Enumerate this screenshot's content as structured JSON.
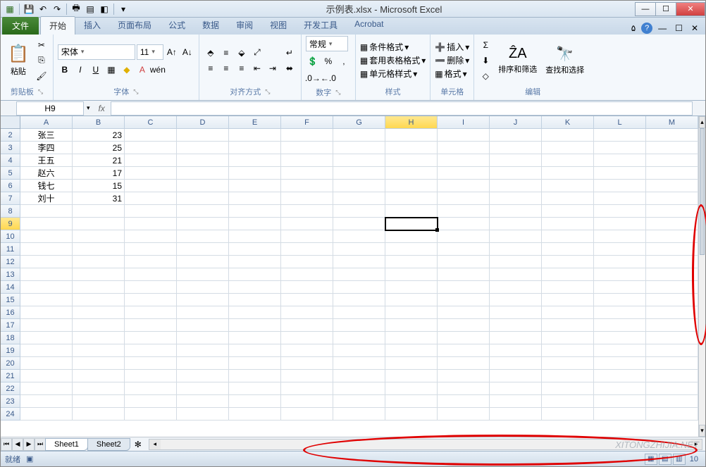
{
  "title": "示例表.xlsx - Microsoft Excel",
  "tabs": {
    "file": "文件",
    "items": [
      "开始",
      "插入",
      "页面布局",
      "公式",
      "数据",
      "审阅",
      "视图",
      "开发工具",
      "Acrobat"
    ],
    "active": 0
  },
  "ribbon": {
    "clipboard": {
      "paste": "粘贴",
      "label": "剪贴板"
    },
    "font": {
      "name": "宋体",
      "size": "11",
      "label": "字体"
    },
    "align": {
      "label": "对齐方式"
    },
    "number": {
      "format": "常规",
      "label": "数字"
    },
    "styles": {
      "cond": "条件格式",
      "table": "套用表格格式",
      "cell": "单元格样式",
      "label": "样式"
    },
    "cells": {
      "insert": "插入",
      "delete": "删除",
      "format": "格式",
      "label": "单元格"
    },
    "editing": {
      "sort": "排序和筛选",
      "find": "查找和选择",
      "label": "编辑"
    }
  },
  "nameBox": "H9",
  "columns": [
    "A",
    "B",
    "C",
    "D",
    "E",
    "F",
    "G",
    "H",
    "I",
    "J",
    "K",
    "L",
    "M"
  ],
  "rows": [
    2,
    3,
    4,
    5,
    6,
    7,
    8,
    9,
    10,
    11,
    12,
    13,
    14,
    15,
    16,
    17,
    18,
    19,
    20,
    21,
    22,
    23,
    24
  ],
  "data": {
    "2": {
      "A": "张三",
      "B": "23"
    },
    "3": {
      "A": "李四",
      "B": "25"
    },
    "4": {
      "A": "王五",
      "B": "21"
    },
    "5": {
      "A": "赵六",
      "B": "17"
    },
    "6": {
      "A": "钱七",
      "B": "15"
    },
    "7": {
      "A": "刘十",
      "B": "31"
    }
  },
  "selectedCell": {
    "row": 9,
    "col": "H"
  },
  "sheets": [
    "Sheet1",
    "Sheet2"
  ],
  "activeSheet": 0,
  "status": "就绪",
  "zoom": "10",
  "watermark": "XITONGZHIJIA.NET"
}
